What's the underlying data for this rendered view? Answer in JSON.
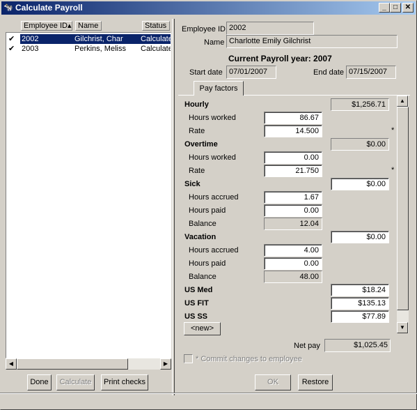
{
  "window": {
    "title": "Calculate Payroll"
  },
  "list": {
    "headers": [
      "Employee ID",
      "Name",
      "Status"
    ],
    "rows": [
      {
        "check": "✔",
        "id": "2002",
        "name": "Gilchrist, Char",
        "status": "Calculate",
        "selected": true
      },
      {
        "check": "✔",
        "id": "2003",
        "name": "Perkins, Meliss",
        "status": "Calculate",
        "selected": false
      }
    ]
  },
  "buttons": {
    "done": "Done",
    "calculate": "Calculate",
    "print": "Print checks",
    "ok": "OK",
    "restore": "Restore"
  },
  "employee": {
    "id_label": "Employee ID",
    "id": "2002",
    "name_label": "Name",
    "name": "Charlotte Emily Gilchrist"
  },
  "payroll": {
    "year_title": "Current Payroll year: 2007",
    "start_label": "Start date",
    "start": "07/01/2007",
    "end_label": "End date",
    "end": "07/15/2007"
  },
  "tab": "Pay factors",
  "factors": [
    {
      "label": "Hourly",
      "bold": true,
      "total": "$1,256.71",
      "total_ro": true
    },
    {
      "label": "Hours worked",
      "value": "86.67"
    },
    {
      "label": "Rate",
      "value": "14.500",
      "star": "*"
    },
    {
      "label": "Overtime",
      "bold": true,
      "total": "$0.00",
      "total_ro": true
    },
    {
      "label": "Hours worked",
      "value": "0.00"
    },
    {
      "label": "Rate",
      "value": "21.750",
      "star": "*"
    },
    {
      "label": "Sick",
      "bold": true,
      "total": "$0.00"
    },
    {
      "label": "Hours accrued",
      "value": "1.67"
    },
    {
      "label": "Hours paid",
      "value": "0.00"
    },
    {
      "label": "Balance",
      "value": "12.04",
      "value_ro": true
    },
    {
      "label": "Vacation",
      "bold": true,
      "total": "$0.00"
    },
    {
      "label": "Hours accrued",
      "value": "4.00"
    },
    {
      "label": "Hours paid",
      "value": "0.00"
    },
    {
      "label": "Balance",
      "value": "48.00",
      "value_ro": true
    },
    {
      "label": "US Med",
      "bold": true,
      "total": "$18.24"
    },
    {
      "label": "US FIT",
      "bold": true,
      "total": "$135.13"
    },
    {
      "label": "US SS",
      "bold": true,
      "total": "$77.89"
    }
  ],
  "new_button": "<new>",
  "net_pay": {
    "label": "Net pay",
    "value": "$1,025.45"
  },
  "commit": {
    "label": "* Commit changes to employee",
    "checked": false
  }
}
